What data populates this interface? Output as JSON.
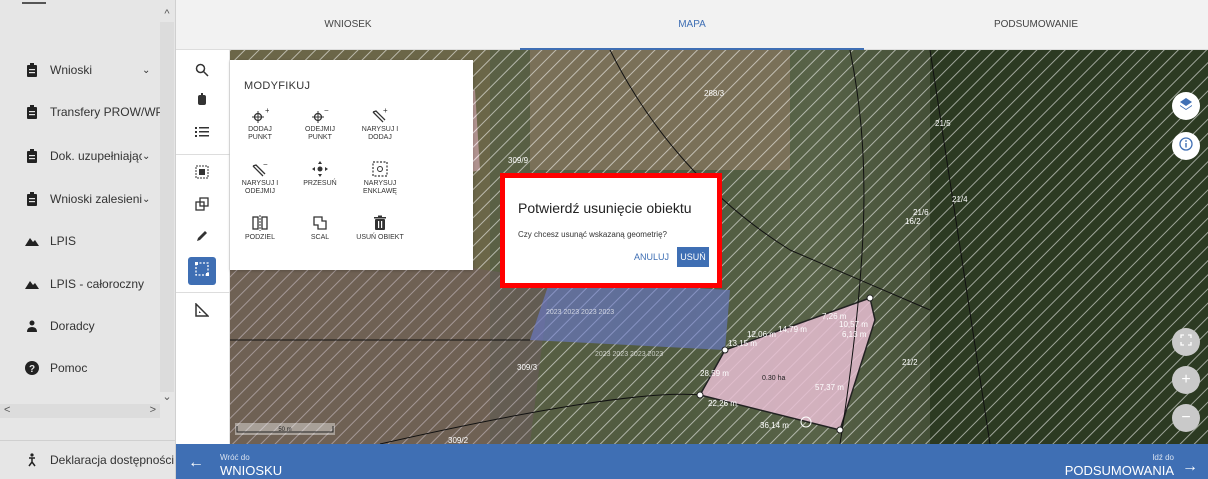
{
  "sidebar": {
    "items": [
      {
        "label": "Wnioski",
        "icon": "clipboard-icon",
        "chevron": "⌄"
      },
      {
        "label": "Transfery PROW/WPR",
        "icon": "clipboard-icon",
        "chevron": ""
      },
      {
        "label": "Dok. uzupełniające",
        "icon": "clipboard-icon",
        "chevron": "⌄"
      },
      {
        "label": "Wnioski zalesieniowe",
        "icon": "clipboard-icon",
        "chevron": "⌄"
      },
      {
        "label": "LPIS",
        "icon": "mountain-icon",
        "chevron": ""
      },
      {
        "label": "LPIS - całoroczny",
        "icon": "mountain-icon",
        "chevron": ""
      },
      {
        "label": "Doradcy",
        "icon": "person-icon",
        "chevron": ""
      },
      {
        "label": "Pomoc",
        "icon": "help-icon",
        "chevron": ""
      }
    ],
    "accessibility_label": "Deklaracja dostępności"
  },
  "tabs": [
    {
      "label": "WNIOSEK",
      "active": false
    },
    {
      "label": "MAPA",
      "active": true
    },
    {
      "label": "PODSUMOWANIE",
      "active": false
    }
  ],
  "modify_panel": {
    "title": "MODYFIKUJ",
    "tools": [
      {
        "label1": "DODAJ",
        "label2": "PUNKT"
      },
      {
        "label1": "ODEJMIJ",
        "label2": "PUNKT"
      },
      {
        "label1": "NARYSUJ I",
        "label2": "DODAJ"
      },
      {
        "label1": "NARYSUJ I",
        "label2": "ODEJMIJ"
      },
      {
        "label1": "PRZESUŃ",
        "label2": ""
      },
      {
        "label1": "NARYSUJ",
        "label2": "ENKLAWĘ"
      },
      {
        "label1": "PODZIEL",
        "label2": ""
      },
      {
        "label1": "SCAL",
        "label2": ""
      },
      {
        "label1": "USUŃ OBIEKT",
        "label2": ""
      }
    ]
  },
  "dialog": {
    "title": "Potwierdź usunięcie obiektu",
    "message": "Czy chcesz usunąć wskazaną geometrię?",
    "cancel": "ANULUJ",
    "confirm": "USUŃ"
  },
  "map": {
    "parcel_labels": [
      "288/3",
      "21/5",
      "309/9",
      "21/6",
      "16/2",
      "21/4",
      "309/3",
      "21/2",
      "309/2"
    ],
    "measurements": [
      "12,06 m",
      "14,79 m",
      "7,26 m",
      "10,57 m",
      "13,15 m",
      "6,13 m",
      "28,59 m",
      "0.30 ha",
      "57,37 m",
      "22,26 m",
      "36,14 m"
    ],
    "year_overlay": "2023 2023 2023 2023",
    "scale_label": "50 m",
    "colors": {
      "accent": "#3f6fb4",
      "highlight": "#ff0000",
      "parcel_pink": "#e8b4c8",
      "parcel_blue": "#6a7bd4"
    }
  },
  "bottombar": {
    "back_small": "Wróć do",
    "back_big": "WNIOSKU",
    "next_small": "Idź do",
    "next_big": "PODSUMOWANIA"
  }
}
